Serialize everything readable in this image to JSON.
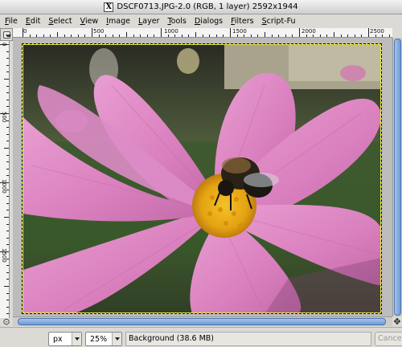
{
  "window": {
    "title": "DSCF0713.JPG-2.0 (RGB, 1 layer) 2592x1944",
    "x_logo": "X"
  },
  "menu": {
    "items": [
      "File",
      "Edit",
      "Select",
      "View",
      "Image",
      "Layer",
      "Tools",
      "Dialogs",
      "Filters",
      "Script-Fu"
    ]
  },
  "rulers": {
    "horizontal_labels": [
      "0",
      "500",
      "1000",
      "1500",
      "2000",
      "2500"
    ],
    "vertical_labels": [
      "0",
      "500",
      "1000",
      "1500"
    ]
  },
  "status": {
    "unit": "px",
    "zoom": "25%",
    "message": "Background (38.6 MB)",
    "cancel_label": "Cancel"
  },
  "icons": {
    "corner": "quick-mask-toggle-icon",
    "nav_left": "pointer-icon",
    "nav_right": "navigate-icon"
  }
}
